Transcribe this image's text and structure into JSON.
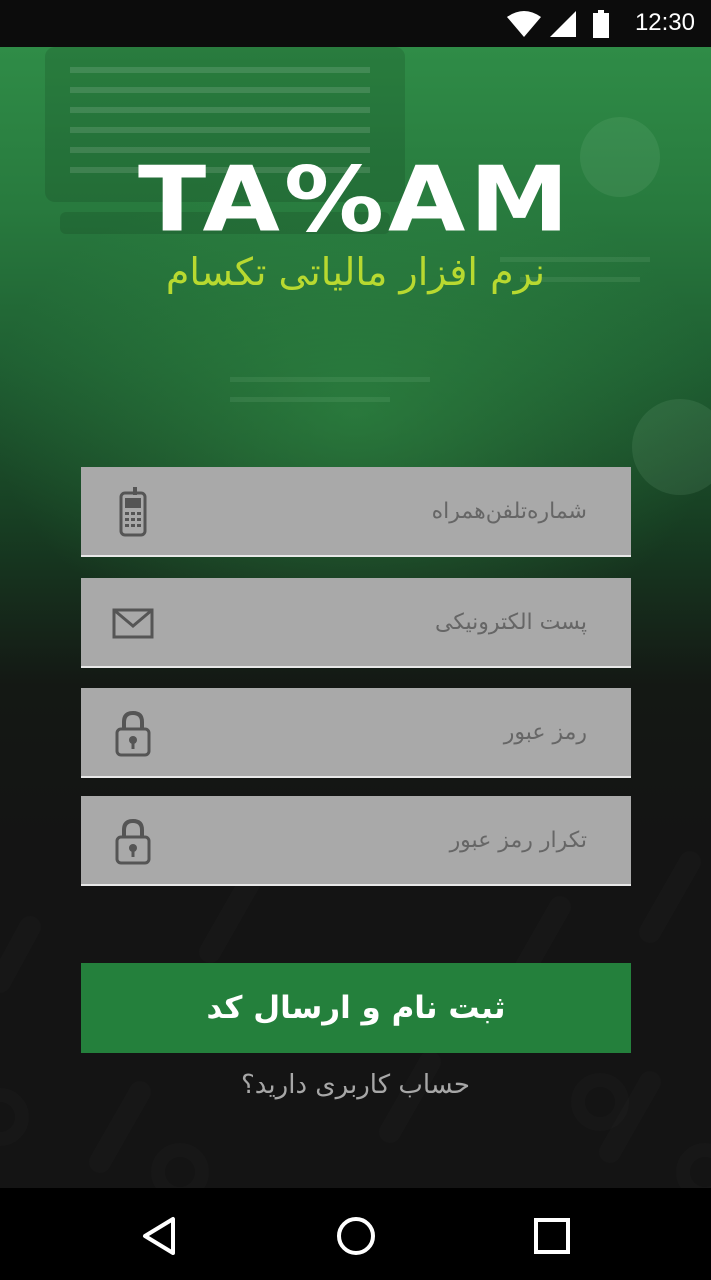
{
  "status_bar": {
    "time": "12:30",
    "icons": [
      "wifi-icon",
      "signal-icon",
      "battery-icon"
    ]
  },
  "brand": {
    "wordmark": "TA%AM",
    "subtitle": "نرم افزار مالیاتی تکسام"
  },
  "form": {
    "phone": {
      "placeholder": "شماره‌تلفن‌همراه",
      "icon": "mobile-phone-icon"
    },
    "email": {
      "placeholder": "پست الکترونیکی",
      "icon": "envelope-icon"
    },
    "password": {
      "placeholder": "رمز عبور",
      "icon": "lock-icon"
    },
    "password_repeat": {
      "placeholder": "تکرار رمز عبور",
      "icon": "lock-icon"
    },
    "submit_label": "ثبت نام و ارسال کد",
    "login_link": "حساب کاربری دارید؟"
  },
  "navigation": {
    "back": "back-triangle-icon",
    "home": "home-circle-icon",
    "recents": "recents-square-icon"
  },
  "colors": {
    "primary_green": "#24803c",
    "subtitle_lime": "#b8d930",
    "field_bg": "#a9a9a9",
    "page_bg": "#141414"
  }
}
